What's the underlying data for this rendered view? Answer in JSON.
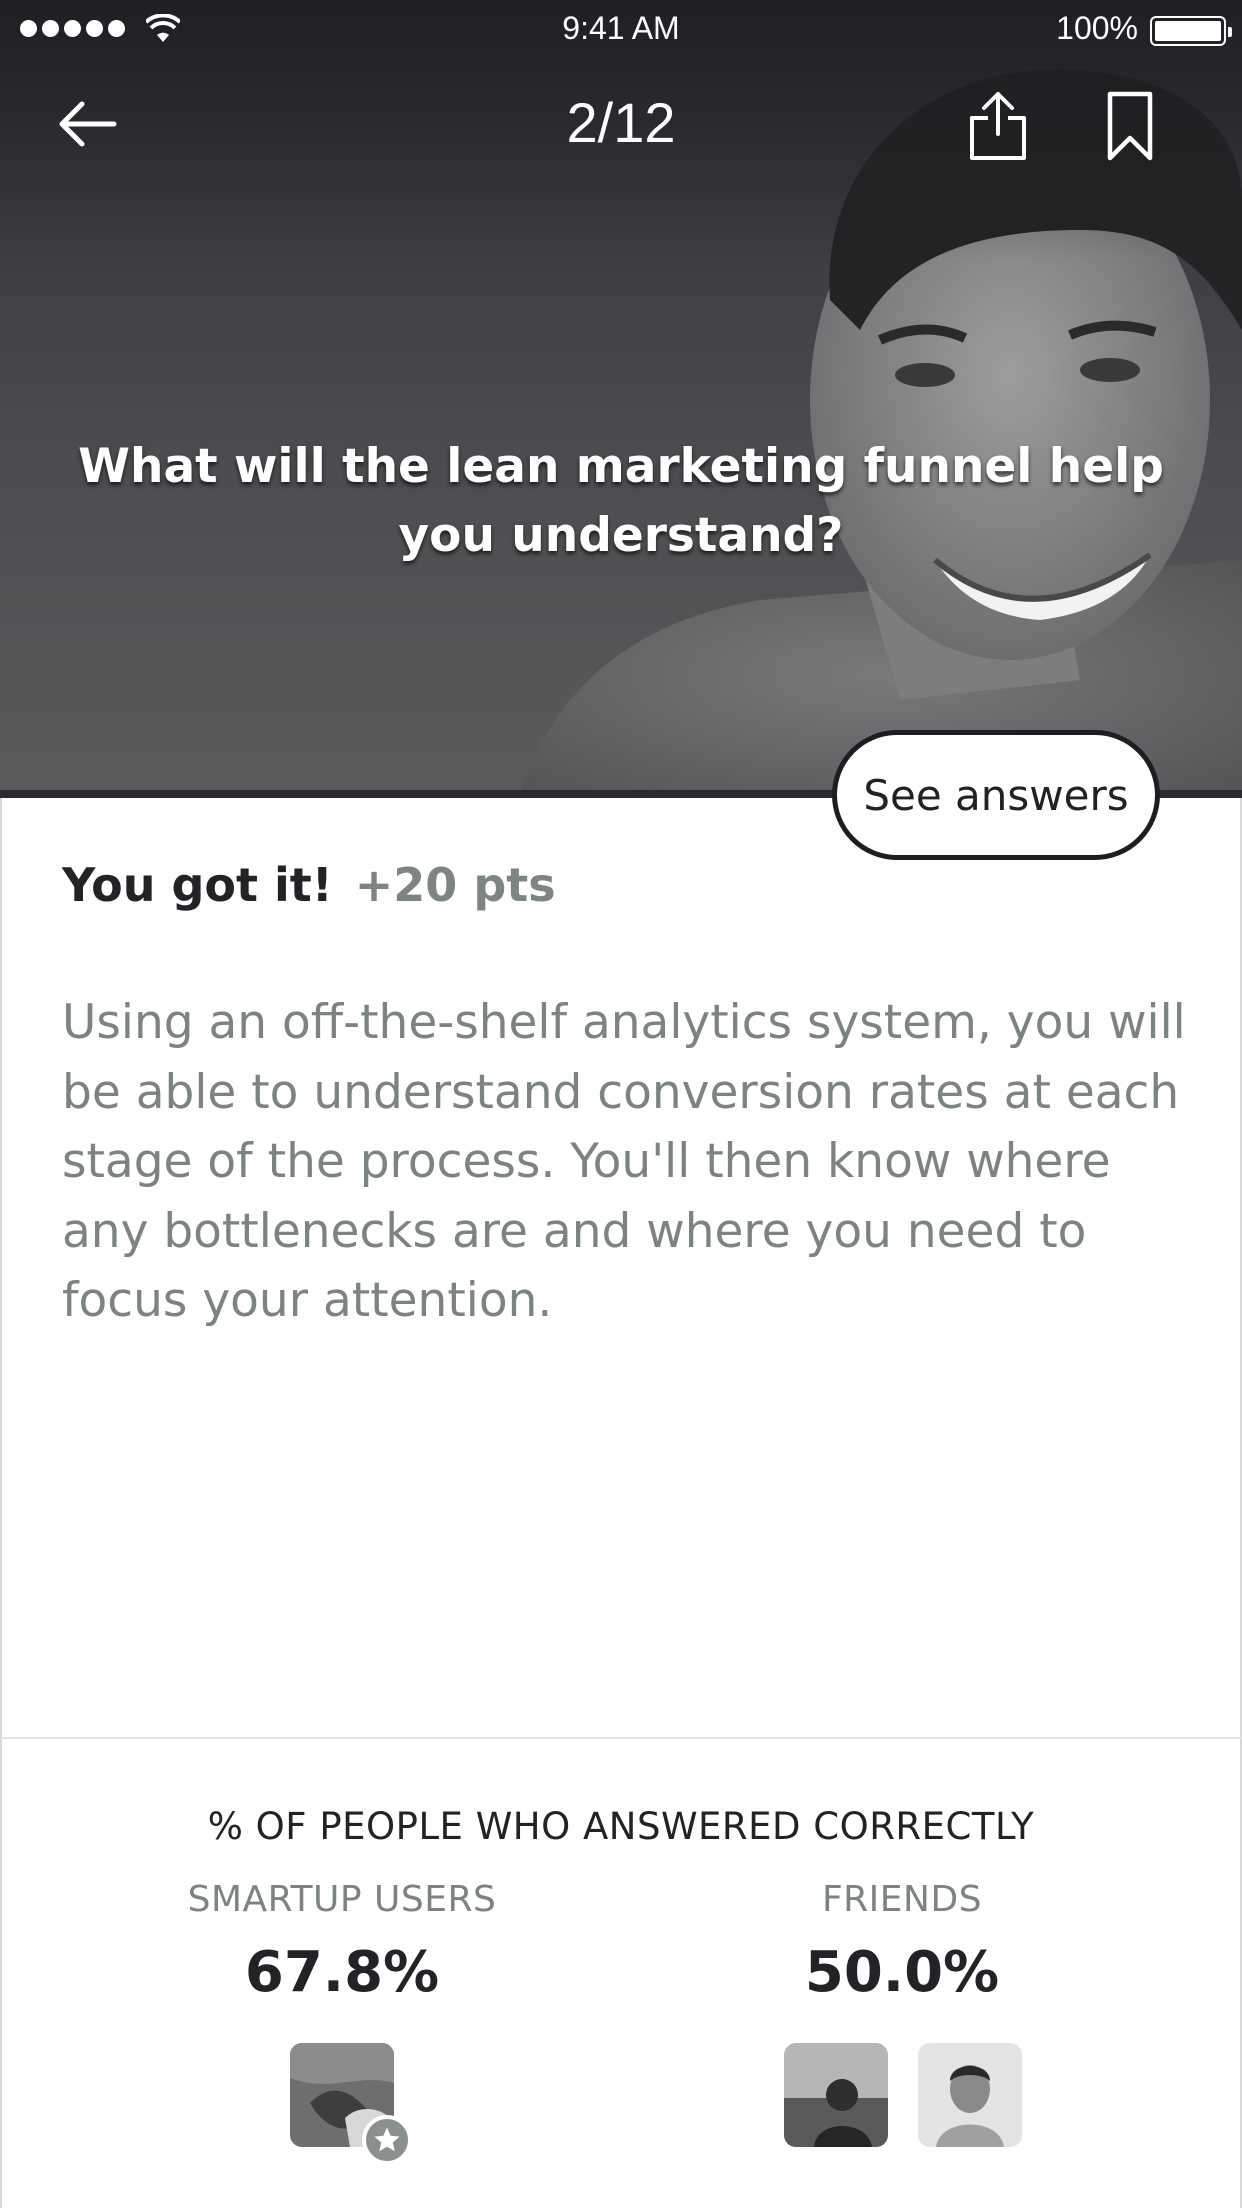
{
  "status_bar": {
    "time": "9:41 AM",
    "battery": "100%",
    "signal_icon": "signal-dots-icon",
    "wifi_icon": "wifi-icon"
  },
  "nav": {
    "counter": "2/12",
    "back_icon": "arrow-left-icon",
    "share_icon": "share-icon",
    "bookmark_icon": "bookmark-icon"
  },
  "question": {
    "text": "What will the lean marketing funnel help you understand?"
  },
  "see_answers_label": "See answers",
  "result": {
    "title": "You got it!",
    "points": "+20 pts",
    "explanation": "Using an off-the-shelf analytics system, you will be able to understand conversion rates at each stage of the process. You'll then know where any bottlenecks are and where you need to focus your attention."
  },
  "stats": {
    "title": "% OF PEOPLE WHO ANSWERED CORRECTLY",
    "smartup": {
      "label": "SMARTUP USERS",
      "value": "67.8%"
    },
    "friends": {
      "label": "FRIENDS",
      "value": "50.0%"
    }
  },
  "colors": {
    "hero_dark": "#2c2c30",
    "text_dark": "#232327",
    "text_grey": "#7b8383"
  }
}
